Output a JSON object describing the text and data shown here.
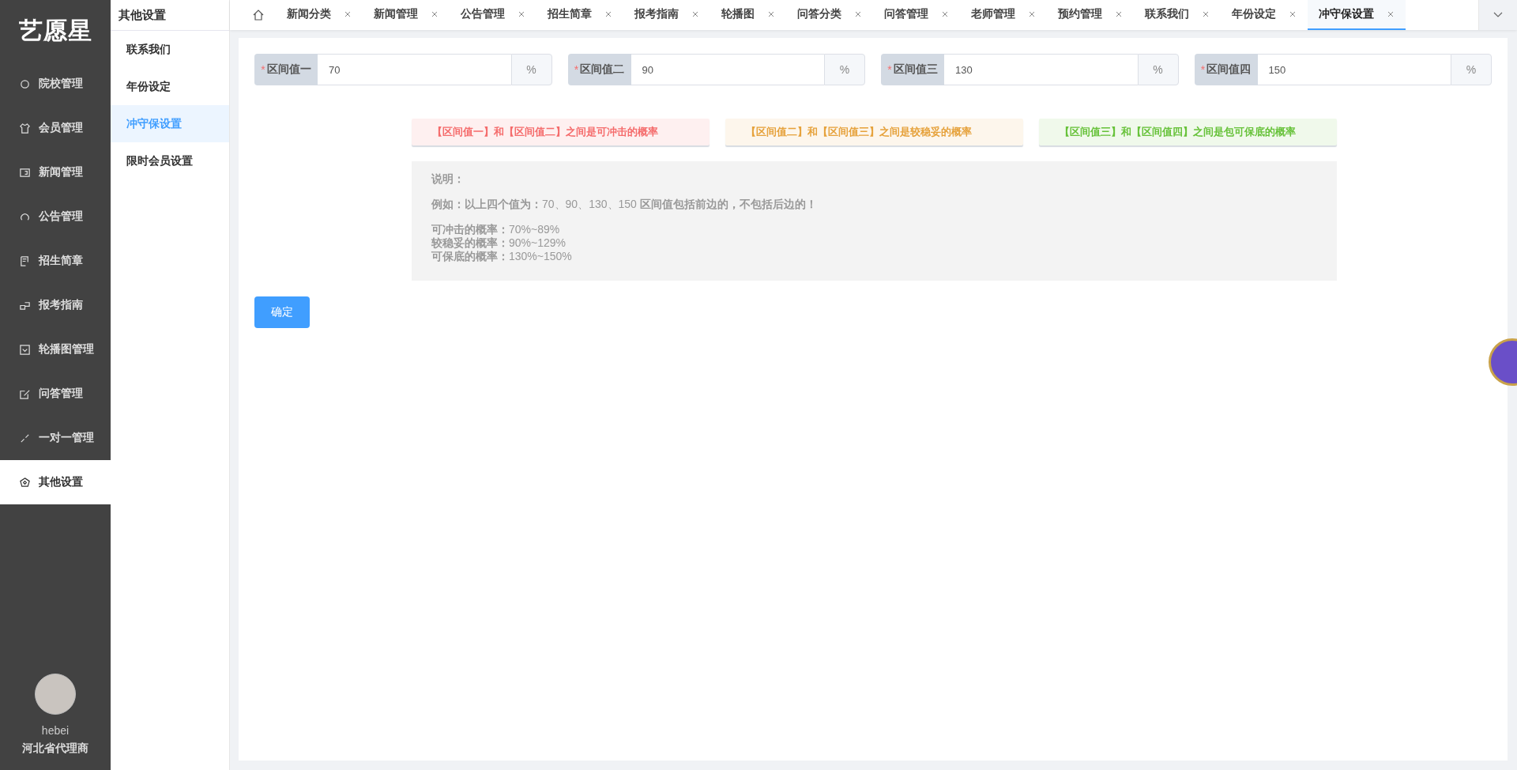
{
  "logo": "艺愿星",
  "sidebar": {
    "items": [
      {
        "label": "院校管理",
        "selected": false
      },
      {
        "label": "会员管理",
        "selected": false
      },
      {
        "label": "新闻管理",
        "selected": false
      },
      {
        "label": "公告管理",
        "selected": false
      },
      {
        "label": "招生简章",
        "selected": false
      },
      {
        "label": "报考指南",
        "selected": false
      },
      {
        "label": "轮播图管理",
        "selected": false
      },
      {
        "label": "问答管理",
        "selected": false
      },
      {
        "label": "一对一管理",
        "selected": false
      },
      {
        "label": "其他设置",
        "selected": true
      }
    ],
    "user": {
      "name": "hebei",
      "role": "河北省代理商"
    }
  },
  "submenu": {
    "title": "其他设置",
    "items": [
      {
        "label": "联系我们",
        "selected": false
      },
      {
        "label": "年份设定",
        "selected": false
      },
      {
        "label": "冲守保设置",
        "selected": true
      },
      {
        "label": "限时会员设置",
        "selected": false
      }
    ]
  },
  "tabs": [
    {
      "label": "新闻分类",
      "selected": false
    },
    {
      "label": "新闻管理",
      "selected": false
    },
    {
      "label": "公告管理",
      "selected": false
    },
    {
      "label": "招生简章",
      "selected": false
    },
    {
      "label": "报考指南",
      "selected": false
    },
    {
      "label": "轮播图",
      "selected": false
    },
    {
      "label": "问答分类",
      "selected": false
    },
    {
      "label": "问答管理",
      "selected": false
    },
    {
      "label": "老师管理",
      "selected": false
    },
    {
      "label": "预约管理",
      "selected": false
    },
    {
      "label": "联系我们",
      "selected": false
    },
    {
      "label": "年份设定",
      "selected": false
    },
    {
      "label": "冲守保设置",
      "selected": true
    }
  ],
  "fields": [
    {
      "required_mark": "*",
      "label": "区间值一",
      "value": "70",
      "suffix": "%"
    },
    {
      "required_mark": "*",
      "label": "区间值二",
      "value": "90",
      "suffix": "%"
    },
    {
      "required_mark": "*",
      "label": "区间值三",
      "value": "130",
      "suffix": "%"
    },
    {
      "required_mark": "*",
      "label": "区间值四",
      "value": "150",
      "suffix": "%"
    }
  ],
  "alerts": [
    {
      "kind": "danger",
      "text": "【区间值一】和【区间值二】之间是可冲击的概率"
    },
    {
      "kind": "warning",
      "text": "【区间值二】和【区间值三】之间是较稳妥的概率"
    },
    {
      "kind": "success",
      "text": "【区间值三】和【区间值四】之间是包可保底的概率"
    }
  ],
  "notes": {
    "title": "说明：",
    "example": "**例如：以上四个值为：**70、90、130、150 **区间值包括前边的，不包括后边的！**",
    "lines": [
      "**可冲击的概率：**70%~89%",
      "**较稳妥的概率：**90%~129%",
      "**可保底的概率：**130%~150%"
    ]
  },
  "confirm_button": "确定"
}
